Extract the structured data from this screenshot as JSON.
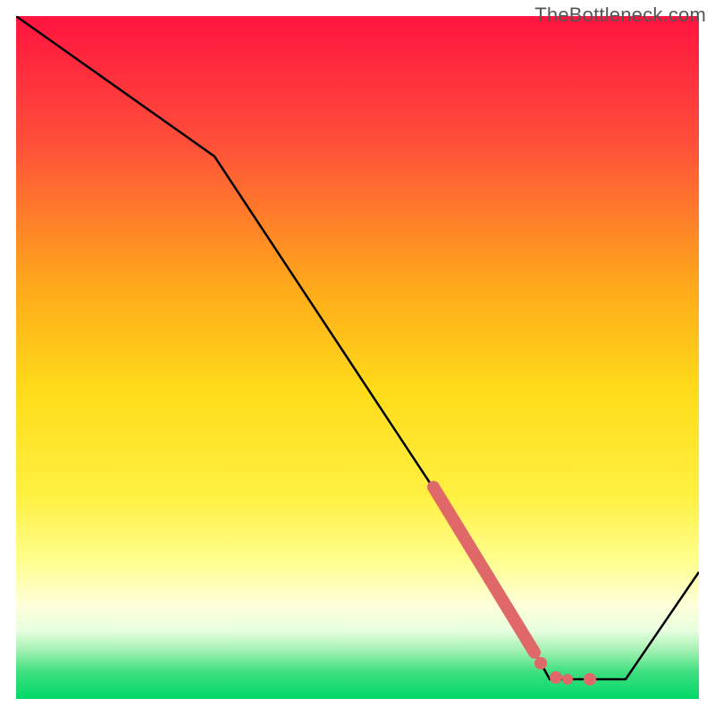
{
  "watermark": "TheBottleneck.com",
  "colors": {
    "top": "#ff1744",
    "mid_upper": "#ff9800",
    "mid": "#ffeb3b",
    "mid_lower": "#fff176",
    "pale_yellow": "#ffffb0",
    "bottom_upper": "#a5d6a7",
    "bottom": "#00e676",
    "line": "#000000",
    "segment": "#e57373",
    "point": "#e57373",
    "border": "#ffffff"
  },
  "chart_data": {
    "type": "line",
    "title": "",
    "xlabel": "",
    "ylabel": "",
    "xlim": [
      0,
      100
    ],
    "ylim": [
      0,
      100
    ],
    "x": [
      0,
      30,
      70,
      77,
      88,
      100
    ],
    "y": [
      100,
      80,
      15,
      3,
      3,
      18
    ],
    "highlighted_segment": {
      "x": [
        60,
        75
      ],
      "y": [
        31,
        6.5
      ]
    },
    "points": [
      {
        "x": 76,
        "y": 5
      },
      {
        "x": 78,
        "y": 3
      },
      {
        "x": 79.5,
        "y": 3
      },
      {
        "x": 82,
        "y": 3
      }
    ],
    "gradient_bands_description": "Vertical gradient background from red (top, worst) through orange, yellow, pale yellow to green (bottom, best); curve descends from top-left, reaches minimum near x≈83, then rises toward right edge."
  }
}
